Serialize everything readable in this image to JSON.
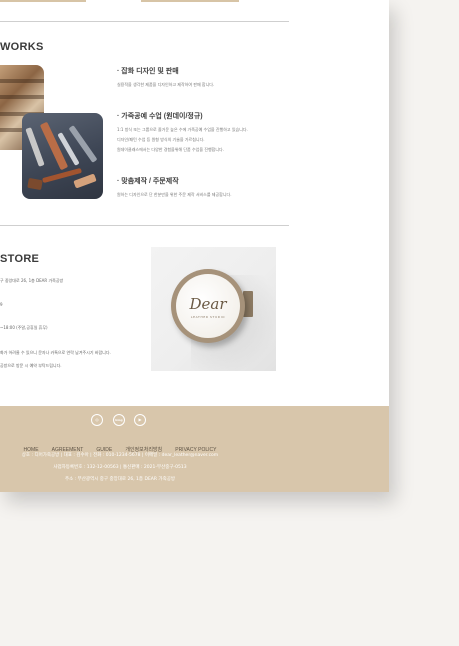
{
  "works": {
    "heading": "WORKS",
    "items": [
      {
        "title": "· 잡화 디자인 및 판매",
        "lines": [
          "실용적을 생각한 제품을 디자인하고 제작하여 판매 합니다."
        ]
      },
      {
        "title": "· 가죽공예 수업 (원데이/정규)",
        "lines": [
          "1:1 방식 또는 그룹으로 즐거운 높은 수에 가죽공예 수업을 진행하고 있습니다.",
          "디자인/패턴 수업 등 원형 방식의 기술을 가르칩니다.",
          "원데이클래스에서는 다양한 경험을위해 단품 수업을 진행합니다."
        ]
      },
      {
        "title": "· 맞춤제작 / 주문제작",
        "lines": [
          "원하는 디자인으로 단 한분만을 위한 주문 제작 서비스를 제공합니다."
        ]
      }
    ]
  },
  "store": {
    "heading": "STORE",
    "lines": [
      "구 중앙대로 26, 1층 DEAR 가죽공방",
      "9",
      "~18:00 (주말,공휴일 휴무)",
      "화가 어려울 수 있으니 문자나 카톡으로 연락 남겨주시기 바랍니다.",
      "공방으로 방문 시 예약 부탁드립니다."
    ],
    "sign": {
      "word": "Dear",
      "sub": "LEATHER STUDIO"
    }
  },
  "footer": {
    "social": [
      {
        "icon": "instagram-icon",
        "glyph": "◎"
      },
      {
        "icon": "blog-icon",
        "glyph": "blog"
      },
      {
        "icon": "youtube-icon",
        "glyph": "▶"
      }
    ],
    "nav": [
      "HOME",
      "AGREEMENT",
      "GUIDE",
      "개인정보처리방침",
      "PRIVACY POLICY"
    ],
    "info": [
      "상호 : 디어가죽공방 | 대표 : 김수아 | 전화 : 010-1234-5678 | 이메일 : dear_leather@naver.com",
      "사업자등록번호 : 132-12-00563 | 통신판매 : 2021-부산중구-0513",
      "주소 : 부산광역시 중구 중앙대로 26, 1층 DEAR 가죽공방"
    ]
  },
  "colors": {
    "footer_bg": "#d8c6ab",
    "accent": "#d7c4a6",
    "page_bg": "#f5f3f0"
  }
}
